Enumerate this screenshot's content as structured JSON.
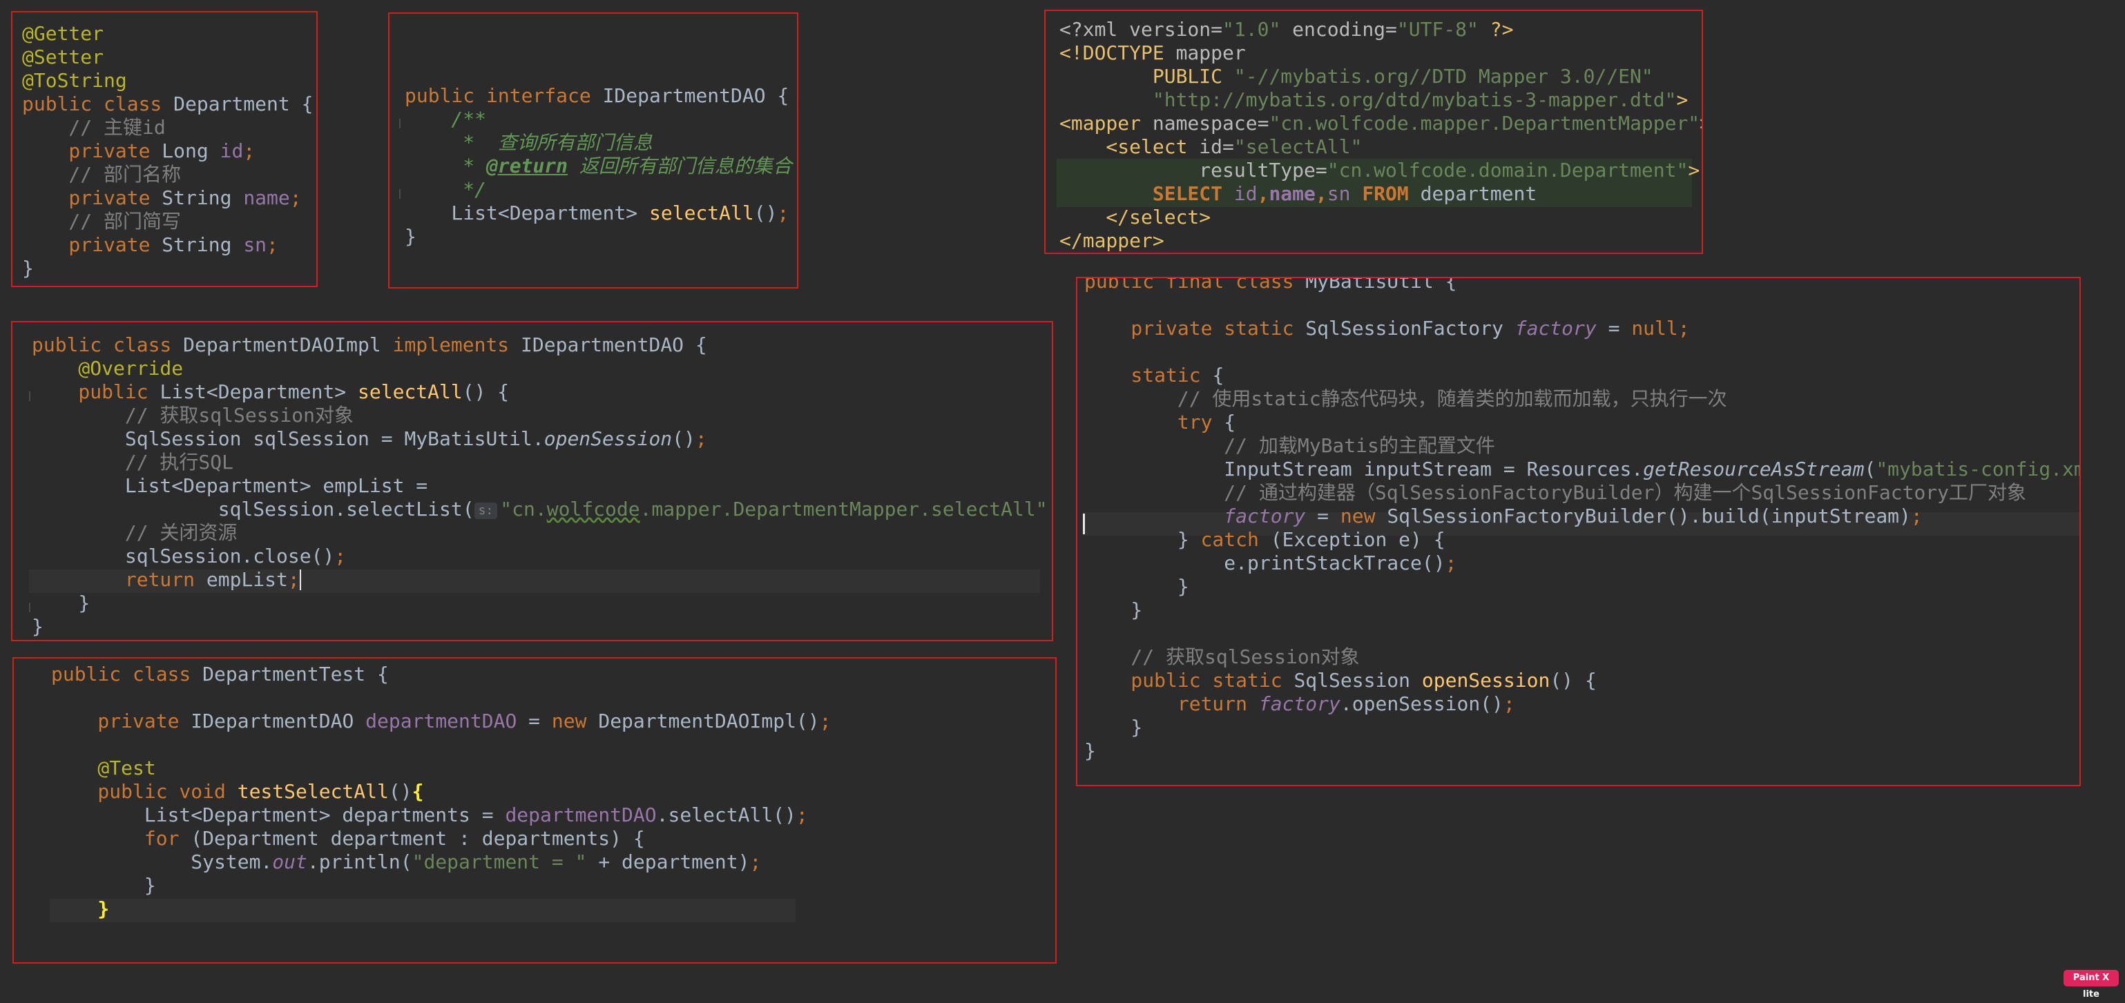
{
  "panels": [
    {
      "name": "department-entity-panel",
      "lines": [
        [
          [
            "ann",
            "@Getter"
          ]
        ],
        [
          [
            "ann",
            "@Setter"
          ]
        ],
        [
          [
            "ann",
            "@ToString"
          ]
        ],
        [
          [
            "kw",
            "public class "
          ],
          [
            "",
            "Department {"
          ]
        ],
        [
          [
            "cm",
            "    // 主键id"
          ]
        ],
        [
          [
            "kw",
            "    private "
          ],
          [
            "",
            "Long "
          ],
          [
            "fld",
            "id"
          ],
          [
            "kw",
            ";"
          ]
        ],
        [
          [
            "cm",
            "    // 部门名称"
          ]
        ],
        [
          [
            "kw",
            "    private "
          ],
          [
            "",
            "String "
          ],
          [
            "fld",
            "name"
          ],
          [
            "kw",
            ";"
          ]
        ],
        [
          [
            "cm",
            "    // 部门简写"
          ]
        ],
        [
          [
            "kw",
            "    private "
          ],
          [
            "",
            "String "
          ],
          [
            "fld",
            "sn"
          ],
          [
            "kw",
            ";"
          ]
        ],
        [
          [
            "",
            "}"
          ]
        ]
      ]
    },
    {
      "name": "dao-interface-panel",
      "lines": [
        [
          [
            "kw",
            "public interface "
          ],
          [
            "",
            "IDepartmentDAO {"
          ]
        ],
        [
          [
            "doc",
            "    /**"
          ]
        ],
        [
          [
            "doc",
            "     *  查询所有部门信息"
          ]
        ],
        [
          [
            "doc",
            "     * "
          ],
          [
            "doctag",
            "@return"
          ],
          [
            "doc",
            " 返回所有部门信息的集合"
          ]
        ],
        [
          [
            "doc",
            "     */"
          ]
        ],
        [
          [
            "",
            "    List<Department> "
          ],
          [
            "mth",
            "selectAll"
          ],
          [
            "",
            "()"
          ],
          [
            "kw",
            ";"
          ]
        ],
        [
          [
            "",
            "}"
          ]
        ]
      ]
    },
    {
      "name": "mapper-xml-panel",
      "lines": [
        [
          [
            "xattr",
            "<?xml version="
          ],
          [
            "str",
            "\"1.0\""
          ],
          [
            "xattr",
            " encoding="
          ],
          [
            "str",
            "\"UTF-8\""
          ],
          [
            "xtag",
            " ?>"
          ]
        ],
        [
          [
            "xtag",
            "<!DOCTYPE "
          ],
          [
            "xattr",
            "mapper"
          ]
        ],
        [
          [
            "xtag",
            "        PUBLIC "
          ],
          [
            "str",
            "\"-//mybatis.org//DTD Mapper 3.0//EN\""
          ]
        ],
        [
          [
            "str",
            "        \"http://mybatis.org/dtd/mybatis-3-mapper.dtd\""
          ],
          [
            "xtag",
            ">"
          ]
        ],
        [
          [
            "xtag",
            "<mapper "
          ],
          [
            "xattr",
            "namespace="
          ],
          [
            "str",
            "\"cn.wolfcode.mapper.DepartmentMapper\""
          ],
          [
            "xtag",
            ">"
          ]
        ],
        [
          [
            "xtag",
            "    <select "
          ],
          [
            "xattr",
            "id="
          ],
          [
            "str",
            "\"selectAll\""
          ]
        ],
        [
          [
            "xattr",
            "            resultType="
          ],
          [
            "str",
            "\"cn.wolfcode.domain.Department\""
          ],
          [
            "xtag",
            ">"
          ]
        ],
        [
          [
            "sqlkw",
            "        SELECT "
          ],
          [
            "sqlcol",
            "id"
          ],
          [
            "sqlkw",
            ","
          ],
          [
            "sqlcolb",
            "name"
          ],
          [
            "sqlkw",
            ","
          ],
          [
            "sqlcol",
            "sn"
          ],
          [
            "sqlkw",
            " FROM "
          ],
          [
            "",
            "department"
          ]
        ],
        [
          [
            "xtag",
            "    </select>"
          ]
        ],
        [
          [
            "xtag",
            "</mapper>"
          ]
        ]
      ]
    },
    {
      "name": "dao-impl-panel",
      "lines": [
        [
          [
            "kw",
            "public class "
          ],
          [
            "",
            "DepartmentDAOImpl "
          ],
          [
            "kw",
            "implements "
          ],
          [
            "",
            "IDepartmentDAO {"
          ]
        ],
        [
          [
            "ann",
            "    @Override"
          ]
        ],
        [
          [
            "kw",
            "    public "
          ],
          [
            "",
            "List<Department> "
          ],
          [
            "mth",
            "selectAll"
          ],
          [
            "",
            "() {"
          ]
        ],
        [
          [
            "cm",
            "        // 获取sqlSession对象"
          ]
        ],
        [
          [
            "",
            "        SqlSession sqlSession = MyBatisUtil."
          ],
          [
            "itl",
            "openSession"
          ],
          [
            "",
            "()"
          ],
          [
            "kw",
            ";"
          ]
        ],
        [
          [
            "cm",
            "        // 执行SQL"
          ]
        ],
        [
          [
            "",
            "        List<Department> empList ="
          ]
        ],
        [
          [
            "",
            "                sqlSession.selectList("
          ],
          [
            "hint",
            "s:"
          ],
          [
            "str",
            "\"cn."
          ],
          [
            "str wavy",
            "wolfcode"
          ],
          [
            "str",
            ".mapper.DepartmentMapper.selectAll\""
          ],
          [
            "",
            "  )"
          ],
          [
            "kw",
            ";"
          ]
        ],
        [
          [
            "cm",
            "        // 关闭资源"
          ]
        ],
        [
          [
            "",
            "        sqlSession.close()"
          ],
          [
            "kw",
            ";"
          ]
        ],
        [
          [
            "kw",
            "        return "
          ],
          [
            "",
            "empList"
          ],
          [
            "kw",
            ";"
          ],
          [
            "caret",
            ""
          ]
        ],
        [
          [
            "",
            "    }"
          ]
        ],
        [
          [
            "",
            "}"
          ]
        ]
      ]
    },
    {
      "name": "department-test-panel",
      "lines": [
        [
          [
            "kw",
            "public class "
          ],
          [
            "",
            "DepartmentTest {"
          ]
        ],
        [
          [
            "",
            ""
          ]
        ],
        [
          [
            "kw",
            "    private "
          ],
          [
            "",
            "IDepartmentDAO "
          ],
          [
            "fld",
            "departmentDAO"
          ],
          [
            "",
            " = "
          ],
          [
            "kw",
            "new "
          ],
          [
            "",
            "DepartmentDAOImpl()"
          ],
          [
            "kw",
            ";"
          ]
        ],
        [
          [
            "",
            ""
          ]
        ],
        [
          [
            "ann",
            "    @Test"
          ]
        ],
        [
          [
            "kw",
            "    public void "
          ],
          [
            "mth",
            "testSelectAll"
          ],
          [
            "",
            "()"
          ],
          [
            "brace",
            "{"
          ]
        ],
        [
          [
            "",
            "        List<Department> departments = "
          ],
          [
            "fld",
            "departmentDAO"
          ],
          [
            "",
            ".selectAll()"
          ],
          [
            "kw",
            ";"
          ]
        ],
        [
          [
            "kw",
            "        for "
          ],
          [
            "",
            "(Department department : departments) {"
          ]
        ],
        [
          [
            "",
            "            System."
          ],
          [
            "fldi",
            "out"
          ],
          [
            "",
            ".println("
          ],
          [
            "str",
            "\"department = \""
          ],
          [
            "",
            " + department)"
          ],
          [
            "kw",
            ";"
          ]
        ],
        [
          [
            "",
            "        }"
          ]
        ],
        [
          [
            "brace",
            "    }"
          ]
        ]
      ]
    },
    {
      "name": "mybatis-util-panel",
      "lines": [
        [
          [
            "kw",
            "public final class "
          ],
          [
            "",
            "MyBatisUtil {"
          ]
        ],
        [
          [
            "",
            ""
          ]
        ],
        [
          [
            "kw",
            "    private static "
          ],
          [
            "",
            "SqlSessionFactory "
          ],
          [
            "fldi",
            "factory"
          ],
          [
            "",
            " = "
          ],
          [
            "kw",
            "null;"
          ]
        ],
        [
          [
            "",
            ""
          ]
        ],
        [
          [
            "kw",
            "    static "
          ],
          [
            "",
            "{"
          ]
        ],
        [
          [
            "cm",
            "        // 使用static静态代码块，随着类的加载而加载，只执行一次"
          ]
        ],
        [
          [
            "kw",
            "        try "
          ],
          [
            "",
            "{"
          ]
        ],
        [
          [
            "cm",
            "            // 加载MyBatis的主配置文件"
          ]
        ],
        [
          [
            "",
            "            InputStream inputStream = Resources."
          ],
          [
            "itl",
            "getResourceAsStream"
          ],
          [
            "",
            "("
          ],
          [
            "str",
            "\"mybatis-config.xml\""
          ],
          [
            "",
            ")"
          ],
          [
            "kw",
            ";"
          ]
        ],
        [
          [
            "cm",
            "            // 通过构建器（SqlSessionFactoryBuilder）构建一个SqlSessionFactory工厂对象"
          ]
        ],
        [
          [
            "fldi",
            "            factory"
          ],
          [
            "",
            " = "
          ],
          [
            "kw",
            "new "
          ],
          [
            "",
            "SqlSessionFactoryBuilder().build(inputStream)"
          ],
          [
            "kw",
            ";"
          ]
        ],
        [
          [
            "",
            "        } "
          ],
          [
            "kw",
            "catch "
          ],
          [
            "",
            "(Exception e) {"
          ]
        ],
        [
          [
            "",
            "            e.printStackTrace()"
          ],
          [
            "kw",
            ";"
          ]
        ],
        [
          [
            "",
            "        }"
          ]
        ],
        [
          [
            "",
            "    }"
          ]
        ],
        [
          [
            "",
            ""
          ]
        ],
        [
          [
            "cm",
            "    // 获取sqlSession对象"
          ]
        ],
        [
          [
            "kw",
            "    public static "
          ],
          [
            "",
            "SqlSession "
          ],
          [
            "mth",
            "openSession"
          ],
          [
            "",
            "() {"
          ]
        ],
        [
          [
            "kw",
            "        return "
          ],
          [
            "fldi",
            "factory"
          ],
          [
            "",
            ".openSession()"
          ],
          [
            "kw",
            ";"
          ]
        ],
        [
          [
            "",
            "    }"
          ]
        ],
        [
          [
            "",
            "}"
          ]
        ]
      ]
    }
  ],
  "badge": {
    "text": "Paint X lite"
  },
  "colors": {
    "background": "#2b2b2b",
    "border": "#d21e1e",
    "text": "#a9b7c6",
    "keyword": "#cc7832",
    "annotation": "#bbb529",
    "string": "#6a8759",
    "comment": "#808080",
    "field": "#9876aa",
    "method": "#ffc66d"
  }
}
